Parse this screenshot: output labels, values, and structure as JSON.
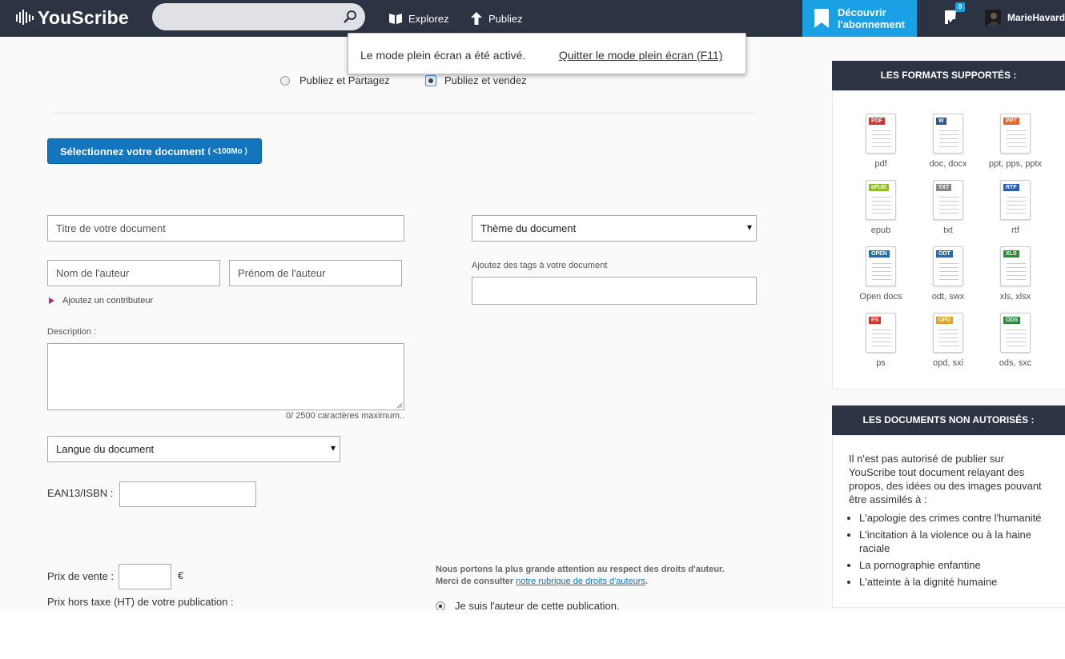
{
  "header": {
    "logo": "YouScribe",
    "search_placeholder": "",
    "nav_explore": "Explorez",
    "nav_publish": "Publiez",
    "discover_line1": "Découvrir",
    "discover_line2": "l'abonnement",
    "cart_count": "0",
    "username": "MarieHavard"
  },
  "fullscreen_notice": {
    "message": "Le mode plein écran a été activé.",
    "quit_link": "Quitter le mode plein écran (F11)"
  },
  "mode": {
    "option_share": "Publiez et Partagez",
    "option_sell": "Publiez et vendez",
    "selected": "Publiez et vendez"
  },
  "upload": {
    "button_label": "Sélectionnez votre document",
    "size_hint": "( <100Mo )"
  },
  "form": {
    "title_placeholder": "Titre de votre document",
    "author_last_placeholder": "Nom de l'auteur",
    "author_first_placeholder": "Prénom de l'auteur",
    "add_contributor": "Ajoutez un contributeur",
    "description_label": "Description :",
    "description_counter": "0/ 2500 caractères maximum..",
    "language_select": "Langue du document",
    "isbn_label": "EAN13/ISBN :",
    "theme_select": "Thème du document",
    "tags_label": "Ajoutez des tags à votre document",
    "price_label": "Prix de vente :",
    "currency": "€",
    "price_ht_label": "Prix hors taxe (HT) de votre publication :",
    "rights_line1": "Nous portons la plus grande attention au respect des droits d'auteur.",
    "rights_line2_prefix": "Merci de consulter ",
    "rights_link": "notre rubrique de droits d'auteurs",
    "rights_line2_suffix": ".",
    "author_confirm": "Je suis l'auteur de cette publication."
  },
  "formats_panel": {
    "title": "LES FORMATS SUPPORTÉS :",
    "formats": [
      {
        "tag": "PDF",
        "name": "pdf",
        "color": "#d9302c"
      },
      {
        "tag": "W",
        "name": "doc, docx",
        "color": "#2b5797"
      },
      {
        "tag": "PPT",
        "name": "ppt, pps, pptx",
        "color": "#e06a2a"
      },
      {
        "tag": "ePUB",
        "name": "epub",
        "color": "#8cbf26"
      },
      {
        "tag": "TXT",
        "name": "txt",
        "color": "#888888"
      },
      {
        "tag": "RTF",
        "name": "rtf",
        "color": "#2b5fb4"
      },
      {
        "tag": "OPEN",
        "name": "Open docs",
        "color": "#1e6bb8"
      },
      {
        "tag": "ODT",
        "name": "odt, swx",
        "color": "#1e6bb8"
      },
      {
        "tag": "XLS",
        "name": "xls, xlsx",
        "color": "#2e8b3a"
      },
      {
        "tag": "PS",
        "name": "ps",
        "color": "#d9302c"
      },
      {
        "tag": "OPD",
        "name": "opd, sxi",
        "color": "#e0a020"
      },
      {
        "tag": "ODS",
        "name": "ods, sxc",
        "color": "#2e8b3a"
      }
    ]
  },
  "rules_panel": {
    "title": "LES DOCUMENTS NON AUTORISÉS :",
    "intro": "Il n'est pas autorisé de publier sur YouScribe tout document relayant des propos, des idées ou des images pouvant être assimilés à :",
    "items": [
      "L'apologie des crimes contre l'humanité",
      "L'incitation à la violence ou à la haine raciale",
      "La pornographie enfantine",
      "L'atteinte à la dignité humaine"
    ]
  }
}
